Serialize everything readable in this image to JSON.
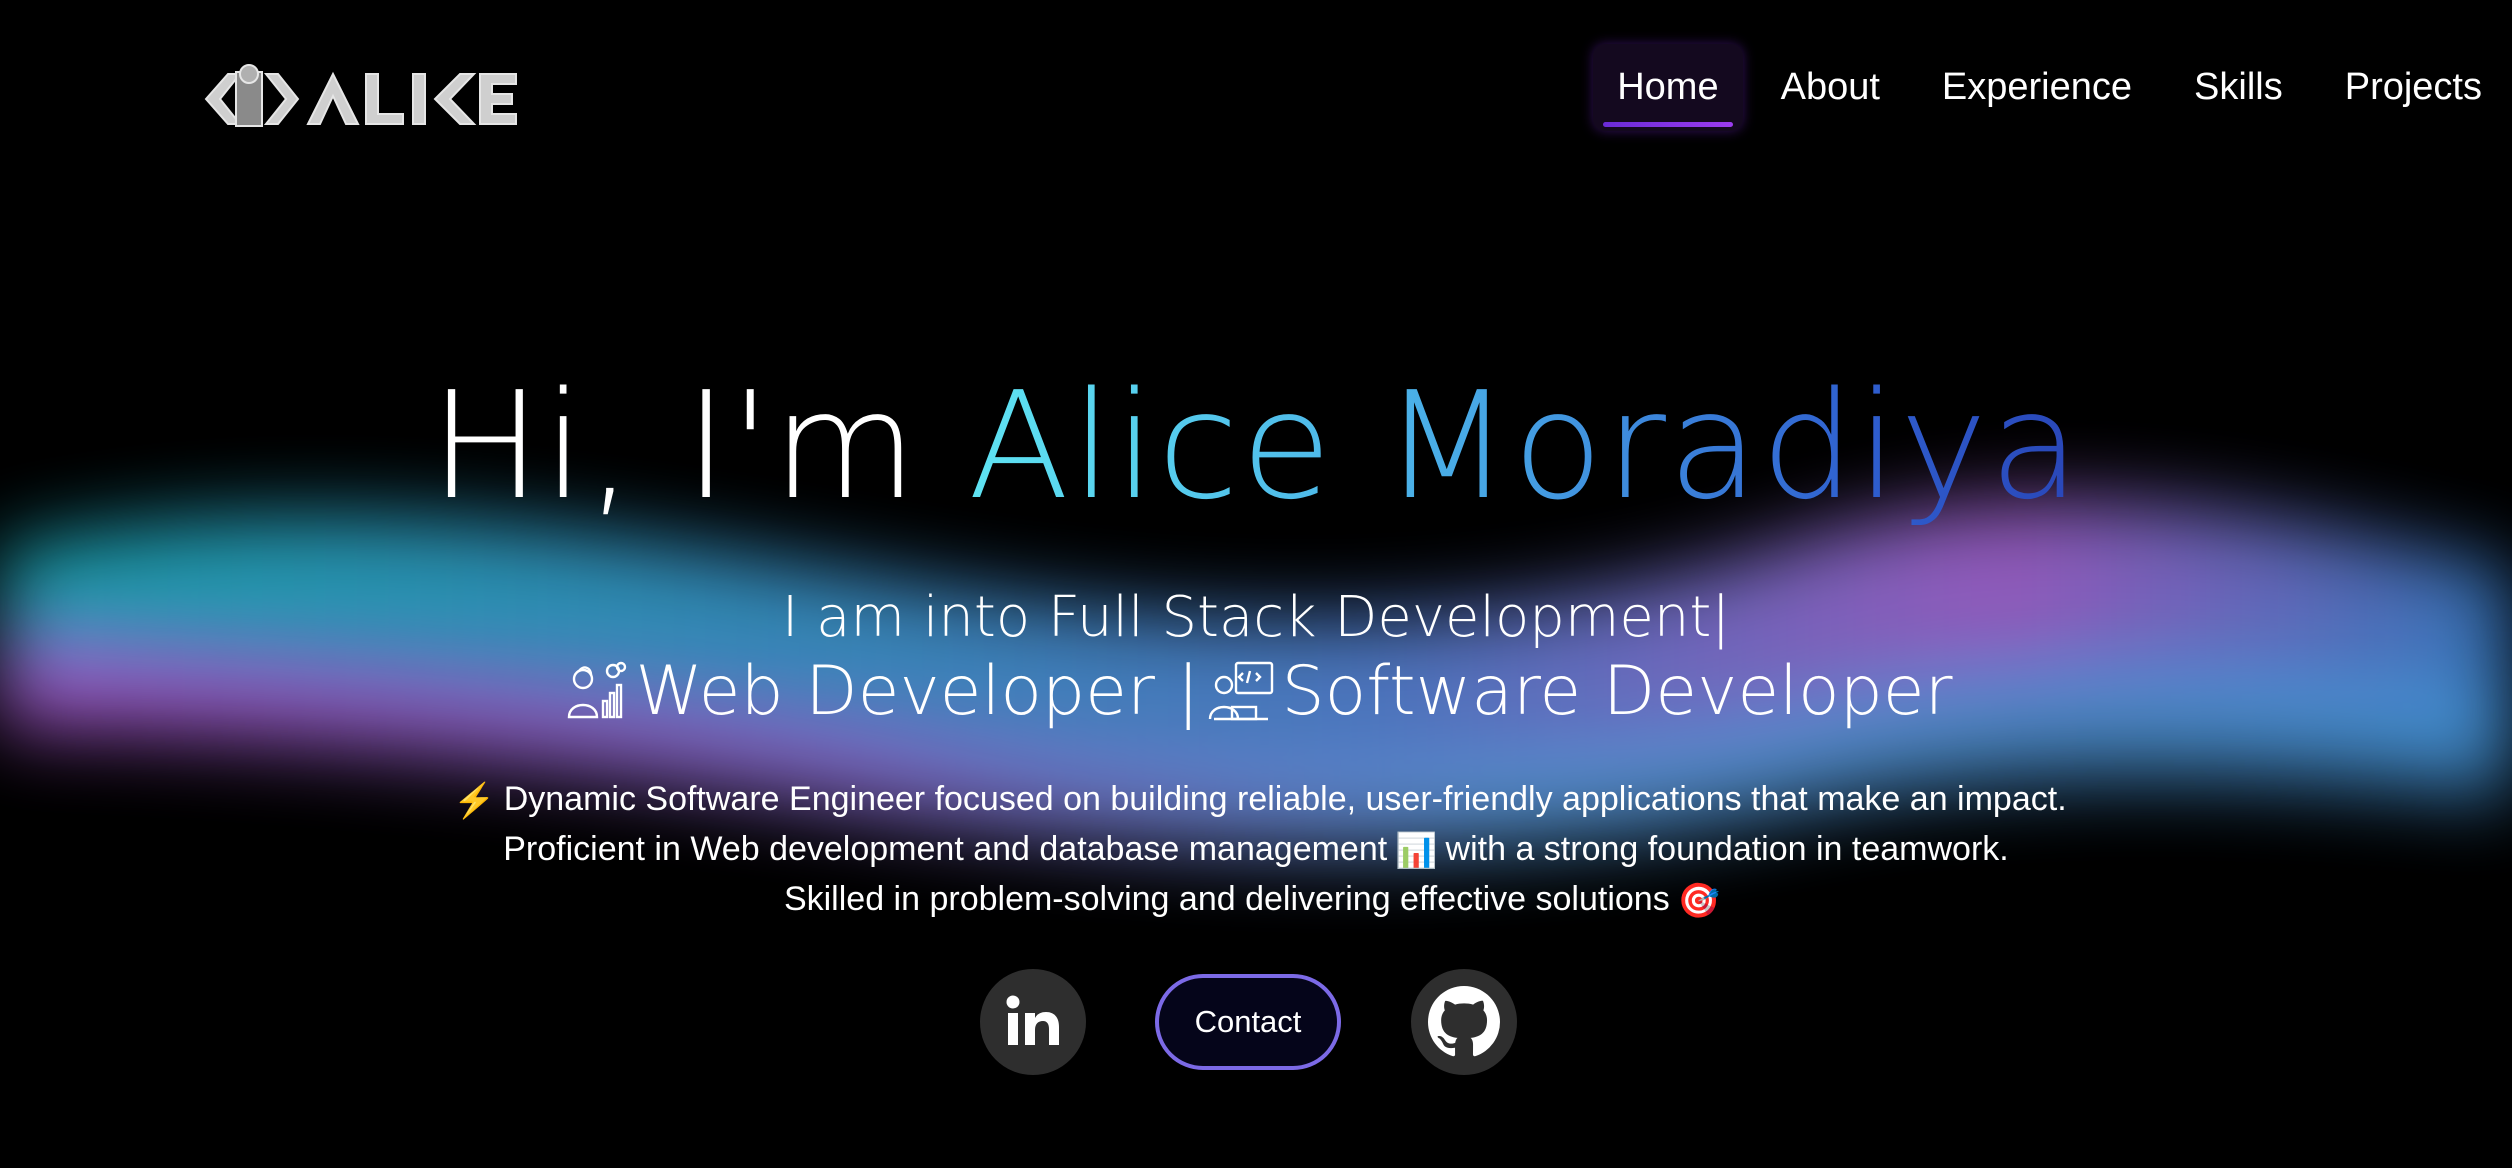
{
  "logo": {
    "alt": "ALICE"
  },
  "nav": {
    "items": [
      {
        "label": "Home",
        "active": true
      },
      {
        "label": "About",
        "active": false
      },
      {
        "label": "Experience",
        "active": false
      },
      {
        "label": "Skills",
        "active": false
      },
      {
        "label": "Projects",
        "active": false
      }
    ]
  },
  "hero": {
    "greeting": "Hi, I'm ",
    "name": "Alice Moradiya",
    "typed_line": "I am into Full Stack Development|",
    "role_1": "Web Developer |",
    "role_2": "Software Developer",
    "description": [
      "Dynamic Software Engineer focused on building reliable, user-friendly applications that make an impact.",
      "Proficient in Web development and database management",
      "with a strong foundation in teamwork.",
      "Skilled in problem-solving and delivering effective solutions"
    ],
    "emojis": {
      "lightning": "⚡",
      "chart": "📊",
      "target": "🎯"
    }
  },
  "actions": {
    "linkedin_icon": "linkedin-icon",
    "contact_label": "Contact",
    "github_icon": "github-icon"
  },
  "colors": {
    "background": "#000000",
    "name_gradient_start": "#5fe3f2",
    "name_gradient_end": "#2946b8",
    "nav_active_bg": "#14091f",
    "nav_active_underline": "#7b35e3",
    "contact_border": "#7c6ae6",
    "wave_cyan": "#2ac6d9",
    "wave_pink": "#c55fe0",
    "wave_blue": "#4a8fe6"
  }
}
